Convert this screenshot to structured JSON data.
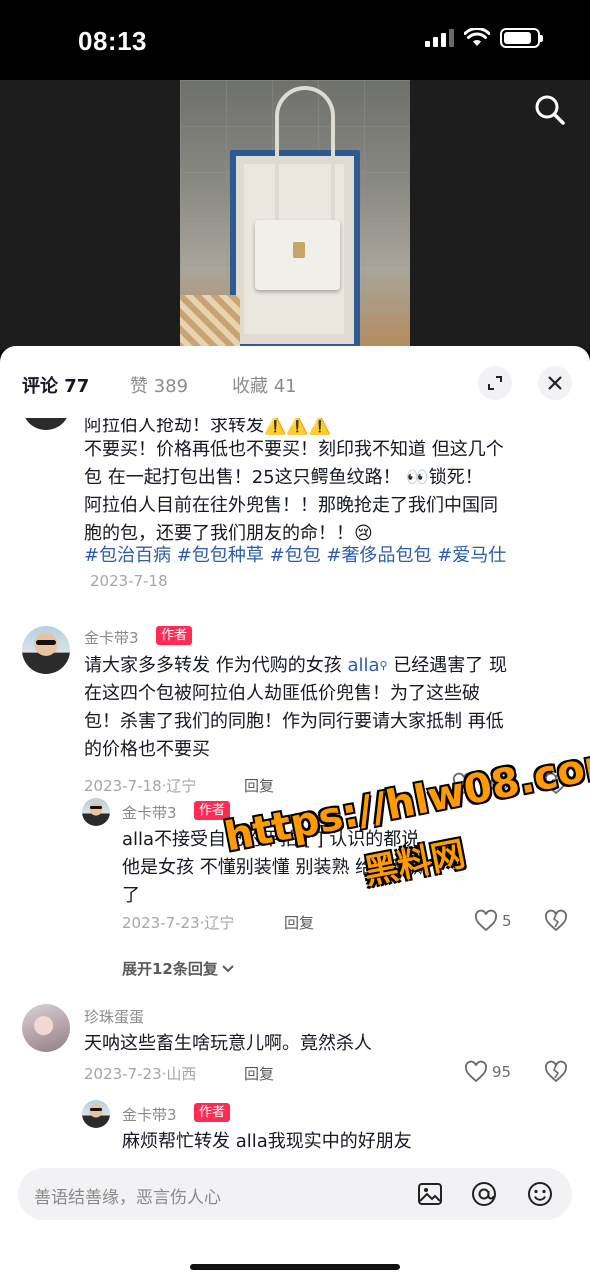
{
  "status_bar": {
    "time": "08:13",
    "battery_level": 0.85,
    "signal_bars": 3,
    "signal_total": 4
  },
  "video": {
    "search_icon": "search-icon"
  },
  "tabs": {
    "comments_label": "评论 77",
    "likes_label": "赞 389",
    "favorites_label": "收藏 41",
    "expand_icon": "expand-icon",
    "close_icon": "close-icon"
  },
  "comments": [
    {
      "lines": [
        "阿拉伯人抢劫！求转发⚠️⚠️⚠️",
        "不要买！价格再低也不要买！刻印我不知道 但这几个",
        "包 在一起打包出售！25这只鳄鱼纹路！ 👀锁死！",
        "阿拉伯人目前在往外兜售！！那晚抢走了我们中国同",
        "胞的包，还要了我们朋友的命！！😢"
      ],
      "hashtags": "#包治百病 #包包种草 #包包 #奢侈品包包 #爱马仕",
      "date": "2023-7-18"
    },
    {
      "author": "金卡带3",
      "tag": "作者",
      "line1_pre": "请大家多多转发 作为代购的女孩 ",
      "line1_link": "alla",
      "line1_post": " 已经遇害了 现",
      "lines": [
        "在这四个包被阿拉伯人劫匪低价兜售！为了这些破",
        "包！杀害了我们的同胞！作为同行要请大家抵制 再低",
        "的价格也不要买"
      ],
      "meta": "2023-7-18·辽宁",
      "reply": "回复",
      "likes": "398"
    },
    {
      "author": "金卡带3",
      "tag": "作者",
      "lines": [
        "alla不接受自己的平拍   [  ]  认识的都说",
        "他是女孩 不懂别装懂 别装熟   给你嘴撕",
        "了"
      ],
      "meta": "2023-7-23·辽宁",
      "reply": "回复",
      "likes": "5"
    },
    {
      "expand_replies": "展开12条回复"
    },
    {
      "author": "珍珠蛋蛋",
      "lines": [
        "天呐这些畜生啥玩意儿啊。竟然杀人"
      ],
      "meta": "2023-7-23·山西",
      "reply": "回复",
      "likes": "95"
    },
    {
      "author": "金卡带3",
      "tag": "作者",
      "lines": [
        "麻烦帮忙转发 alla我现实中的好朋友"
      ]
    }
  ],
  "watermark": {
    "line1": "https://hlw08.com",
    "line2": "黑料网"
  },
  "input_bar": {
    "placeholder": "善语结善缘，恶言伤人心",
    "icons": [
      "image-icon",
      "at-icon",
      "emoji-icon"
    ]
  },
  "colors": {
    "accent": "#fe2c55",
    "link": "#2c5cab",
    "watermark": "#ff9a00"
  }
}
